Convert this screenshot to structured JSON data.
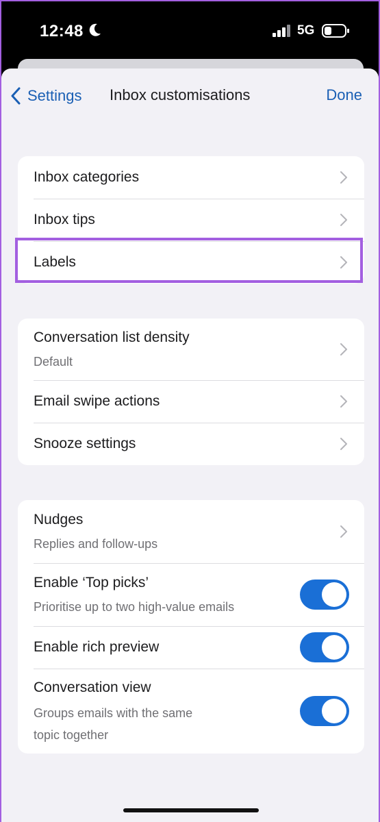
{
  "status_bar": {
    "time": "12:48",
    "network": "5G",
    "icons": [
      "moon-icon",
      "signal-icon",
      "battery-icon"
    ]
  },
  "nav": {
    "back_label": "Settings",
    "title": "Inbox customisations",
    "done_label": "Done",
    "accent_color": "#1a5fb4"
  },
  "group1": {
    "items": [
      {
        "title": "Inbox categories"
      },
      {
        "title": "Inbox tips"
      },
      {
        "title": "Labels",
        "highlighted": true
      }
    ]
  },
  "group2": {
    "items": [
      {
        "title": "Conversation list density",
        "subtitle": "Default"
      },
      {
        "title": "Email swipe actions"
      },
      {
        "title": "Snooze settings"
      }
    ]
  },
  "group3": {
    "items": [
      {
        "title": "Nudges",
        "subtitle": "Replies and follow-ups"
      },
      {
        "title": "Enable ‘Top picks’",
        "subtitle": "Prioritise up to two high-value emails",
        "toggle": true
      },
      {
        "title": "Enable rich preview",
        "toggle": true
      },
      {
        "title": "Conversation view",
        "subtitle_line1": "Groups emails with the same",
        "subtitle_line2": "topic together",
        "toggle": true
      }
    ]
  },
  "colors": {
    "toggle_on": "#1a6fd6",
    "highlight": "#a35fe0"
  }
}
